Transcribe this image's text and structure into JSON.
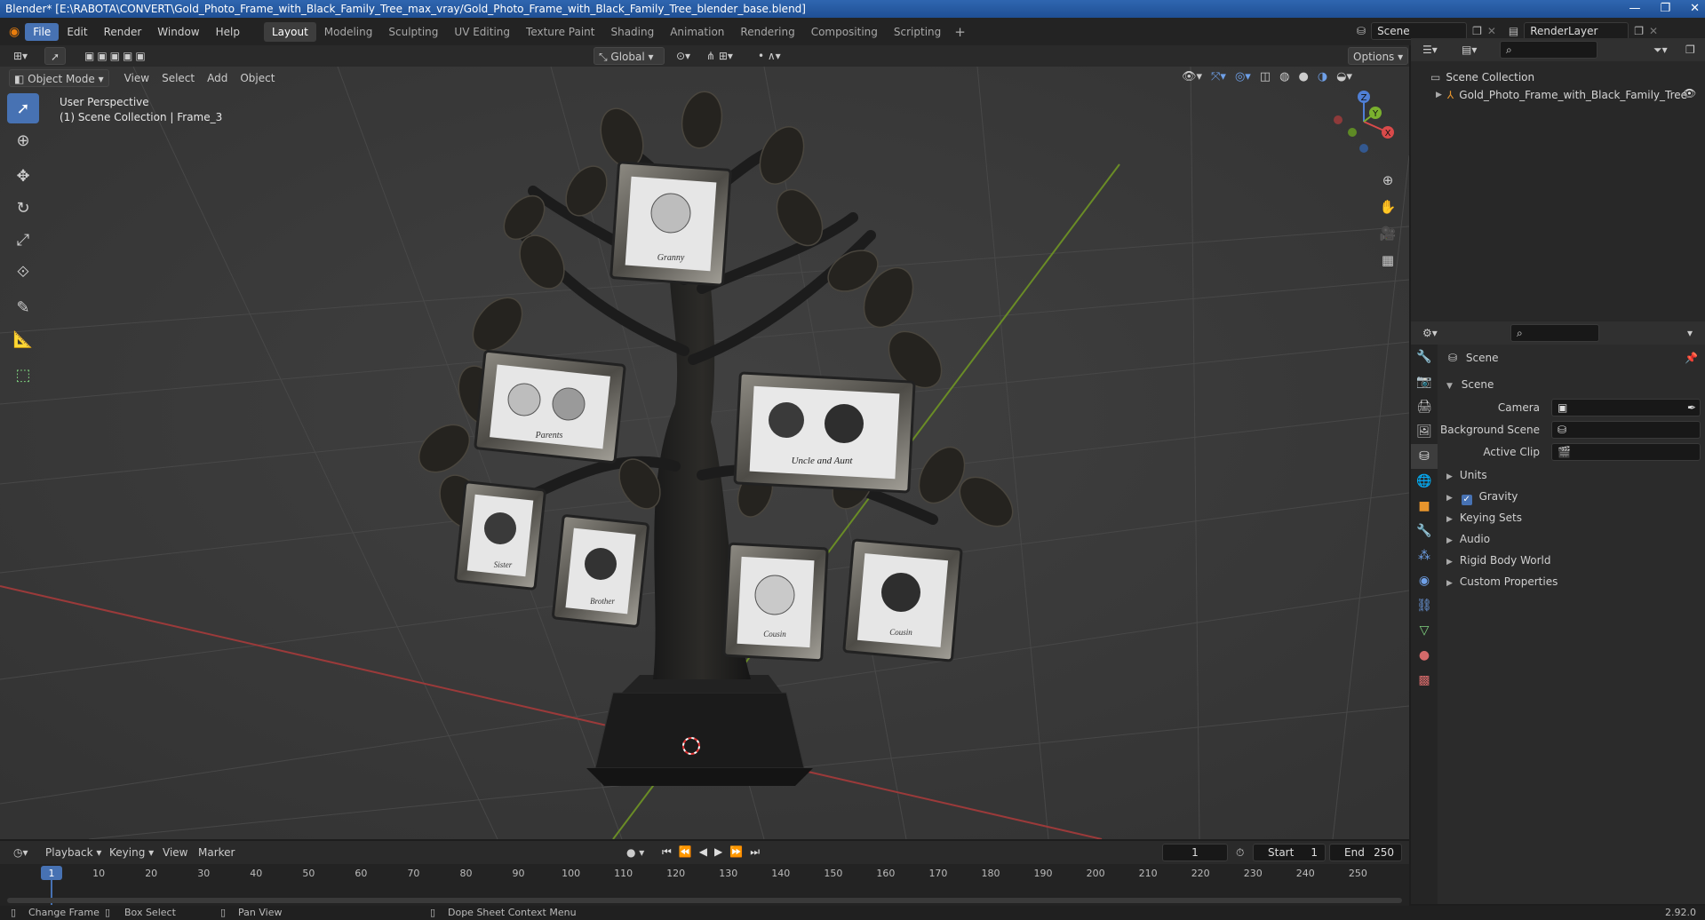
{
  "window": {
    "title": "Blender* [E:\\RABOTA\\CONVERT\\Gold_Photo_Frame_with_Black_Family_Tree_max_vray/Gold_Photo_Frame_with_Black_Family_Tree_blender_base.blend]",
    "controls": [
      "—",
      "❐",
      "✕"
    ]
  },
  "menu": [
    "File",
    "Edit",
    "Render",
    "Window",
    "Help"
  ],
  "workspaces": [
    "Layout",
    "Modeling",
    "Sculpting",
    "UV Editing",
    "Texture Paint",
    "Shading",
    "Animation",
    "Rendering",
    "Compositing",
    "Scripting"
  ],
  "scene_field": "Scene",
  "renderlayer_field": "RenderLayer",
  "viewport": {
    "transform_orientation": "Global",
    "options_label": "Options",
    "mode": "Object Mode",
    "header_menu": [
      "View",
      "Select",
      "Add",
      "Object"
    ],
    "perspective_label": "User Perspective",
    "collection_label": "(1) Scene Collection | Frame_3",
    "gizmo_axes": {
      "x": "X",
      "y": "Y",
      "z": "Z"
    }
  },
  "model_labels": {
    "granny": "Granny",
    "parents": "Parents",
    "uncle_aunt": "Uncle and Aunt",
    "sister": "Sister",
    "brother": "Brother",
    "cousin1": "Cousin",
    "cousin2": "Cousin"
  },
  "outliner": {
    "root": "Scene Collection",
    "items": [
      {
        "label": "Gold_Photo_Frame_with_Black_Family_Tree"
      }
    ]
  },
  "properties": {
    "context": "Scene",
    "panel": "Scene",
    "fields": [
      {
        "label": "Camera"
      },
      {
        "label": "Background Scene"
      },
      {
        "label": "Active Clip"
      }
    ],
    "sections": [
      "Units",
      "Gravity",
      "Keying Sets",
      "Audio",
      "Rigid Body World",
      "Custom Properties"
    ],
    "gravity_checked": true
  },
  "timeline": {
    "menu": [
      "Playback",
      "Keying",
      "View",
      "Marker"
    ],
    "current_frame": "1",
    "start_label": "Start",
    "start_value": "1",
    "end_label": "End",
    "end_value": "250",
    "ticks": [
      "1",
      "10",
      "20",
      "30",
      "40",
      "50",
      "60",
      "70",
      "80",
      "90",
      "100",
      "110",
      "120",
      "130",
      "140",
      "150",
      "160",
      "170",
      "180",
      "190",
      "200",
      "210",
      "220",
      "230",
      "240",
      "250"
    ]
  },
  "statusbar": {
    "items": [
      "Change Frame",
      "Box Select",
      "Pan View",
      "Dope Sheet Context Menu"
    ],
    "version": "2.92.0"
  }
}
